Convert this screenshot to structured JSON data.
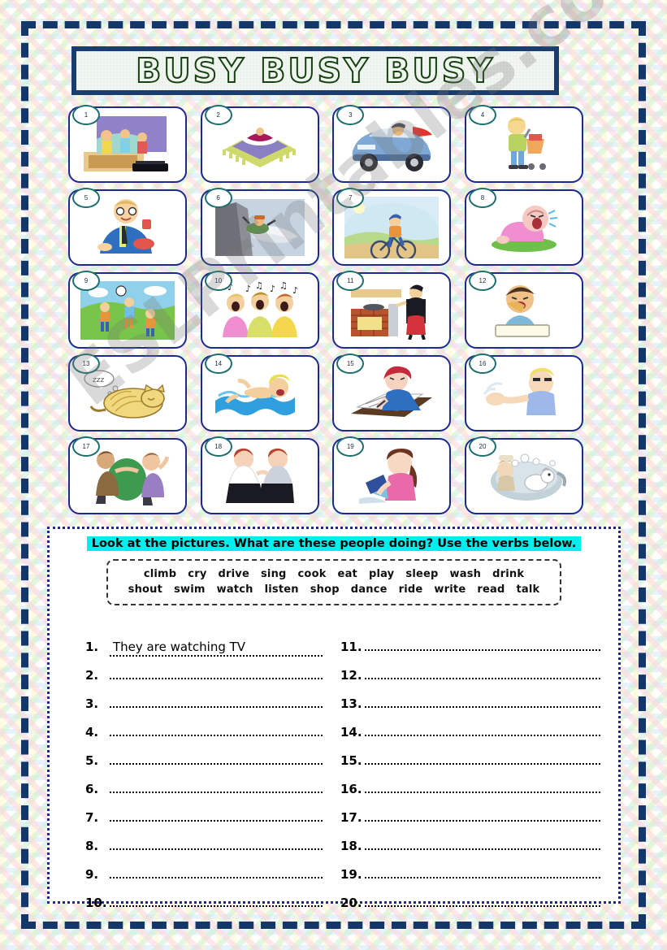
{
  "title": "BUSY BUSY BUSY",
  "watermark": "ESLPrintables.com",
  "colors": {
    "frame_navy": "#13376b",
    "card_border": "#1b2a8c",
    "badge_teal": "#1c6e6e",
    "highlight_cyan": "#00eeee",
    "title_outline_green": "#16400f"
  },
  "instruction": "Look at the pictures.  What are these people doing?  Use the verbs below.",
  "verb_bank": {
    "row1": [
      "climb",
      "cry",
      "drive",
      "sing",
      "cook",
      "eat",
      "play",
      "sleep",
      "wash",
      "drink"
    ],
    "row2": [
      "shout",
      "swim",
      "watch",
      "listen",
      "shop",
      "dance",
      "ride",
      "write",
      "read",
      "talk"
    ]
  },
  "pictures": [
    {
      "number": "1",
      "scene": "family-watching-tv"
    },
    {
      "number": "2",
      "scene": "person-sleeping-in-bed"
    },
    {
      "number": "3",
      "scene": "man-driving-car"
    },
    {
      "number": "4",
      "scene": "boy-shopping-cart"
    },
    {
      "number": "5",
      "scene": "man-eating-drinking"
    },
    {
      "number": "6",
      "scene": "man-climbing-mountain"
    },
    {
      "number": "7",
      "scene": "boy-riding-bicycle"
    },
    {
      "number": "8",
      "scene": "baby-crying"
    },
    {
      "number": "9",
      "scene": "children-playing-football"
    },
    {
      "number": "10",
      "scene": "women-singing"
    },
    {
      "number": "11",
      "scene": "woman-cooking"
    },
    {
      "number": "12",
      "scene": "boy-eating-sandwich"
    },
    {
      "number": "13",
      "scene": "cat-sleeping"
    },
    {
      "number": "14",
      "scene": "girl-swimming"
    },
    {
      "number": "15",
      "scene": "girl-writing"
    },
    {
      "number": "16",
      "scene": "child-washing-hands"
    },
    {
      "number": "17",
      "scene": "couple-dancing"
    },
    {
      "number": "18",
      "scene": "women-talking"
    },
    {
      "number": "19",
      "scene": "girl-reading"
    },
    {
      "number": "20",
      "scene": "washing-dog-in-tub"
    }
  ],
  "answers": {
    "left": [
      {
        "number": "1.",
        "text": "They are watching TV"
      },
      {
        "number": "2.",
        "text": ""
      },
      {
        "number": "3.",
        "text": ""
      },
      {
        "number": "4.",
        "text": ""
      },
      {
        "number": "5.",
        "text": ""
      },
      {
        "number": "6.",
        "text": ""
      },
      {
        "number": "7.",
        "text": ""
      },
      {
        "number": "8.",
        "text": ""
      },
      {
        "number": "9.",
        "text": ""
      },
      {
        "number": "10.",
        "text": ""
      }
    ],
    "right": [
      {
        "number": "11.",
        "text": ""
      },
      {
        "number": "12.",
        "text": ""
      },
      {
        "number": "13.",
        "text": ""
      },
      {
        "number": "14.",
        "text": ""
      },
      {
        "number": "15.",
        "text": ""
      },
      {
        "number": "16.",
        "text": ""
      },
      {
        "number": "17.",
        "text": ""
      },
      {
        "number": "18.",
        "text": ""
      },
      {
        "number": "19.",
        "text": ""
      },
      {
        "number": "20.",
        "text": ""
      }
    ]
  }
}
